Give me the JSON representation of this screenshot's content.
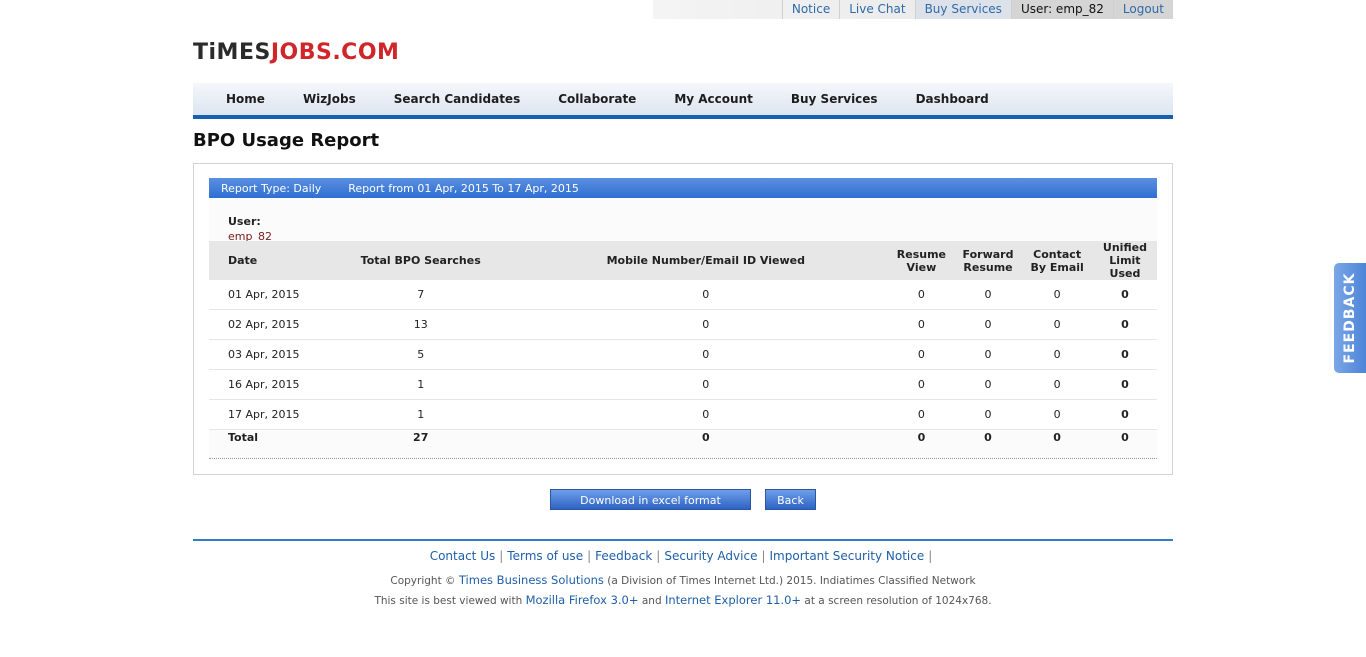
{
  "topbar": {
    "notice": "Notice",
    "live_chat": "Live Chat",
    "buy_services": "Buy Services",
    "user": "User: emp_82",
    "logout": "Logout"
  },
  "logo": {
    "times": "TiMES",
    "jobs": "JOBS.COM"
  },
  "nav": [
    "Home",
    "WizJobs",
    "Search Candidates",
    "Collaborate",
    "My Account",
    "Buy Services",
    "Dashboard"
  ],
  "page_title": "BPO Usage Report",
  "report": {
    "type": "Report Type: Daily",
    "range": "Report from 01 Apr, 2015 To 17 Apr, 2015",
    "user_label": "User:",
    "user_value": "emp_82",
    "columns": [
      "Date",
      "Total BPO Searches",
      "Mobile Number/Email ID Viewed",
      "Resume View",
      "Forward Resume",
      "Contact By Email",
      "Unified Limit Used"
    ],
    "rows": [
      [
        "01 Apr, 2015",
        "7",
        "0",
        "0",
        "0",
        "0",
        "0"
      ],
      [
        "02 Apr, 2015",
        "13",
        "0",
        "0",
        "0",
        "0",
        "0"
      ],
      [
        "03 Apr, 2015",
        "5",
        "0",
        "0",
        "0",
        "0",
        "0"
      ],
      [
        "16 Apr, 2015",
        "1",
        "0",
        "0",
        "0",
        "0",
        "0"
      ],
      [
        "17 Apr, 2015",
        "1",
        "0",
        "0",
        "0",
        "0",
        "0"
      ]
    ],
    "total": [
      "Total",
      "27",
      "0",
      "0",
      "0",
      "0",
      "0"
    ]
  },
  "buttons": {
    "download": "Download in excel format",
    "back": "Back"
  },
  "footer": {
    "links": [
      "Contact Us",
      "Terms of use",
      "Feedback",
      "Security Advice",
      "Important Security Notice"
    ],
    "copyright_pre": "Copyright ©",
    "company": "Times Business Solutions",
    "copyright_post": "(a Division of Times Internet Ltd.) 2015. Indiatimes Classified Network",
    "best_pre": "This site is best viewed with",
    "firefox": "Mozilla Firefox 3.0+",
    "and": "and",
    "ie": "Internet Explorer 11.0+",
    "best_post": "at a screen resolution of 1024x768."
  },
  "feedback_tab": "FEEDBACK",
  "colors": {
    "accent": "#1560b0",
    "link": "#1f5fa8",
    "logo_red": "#d0262a"
  }
}
